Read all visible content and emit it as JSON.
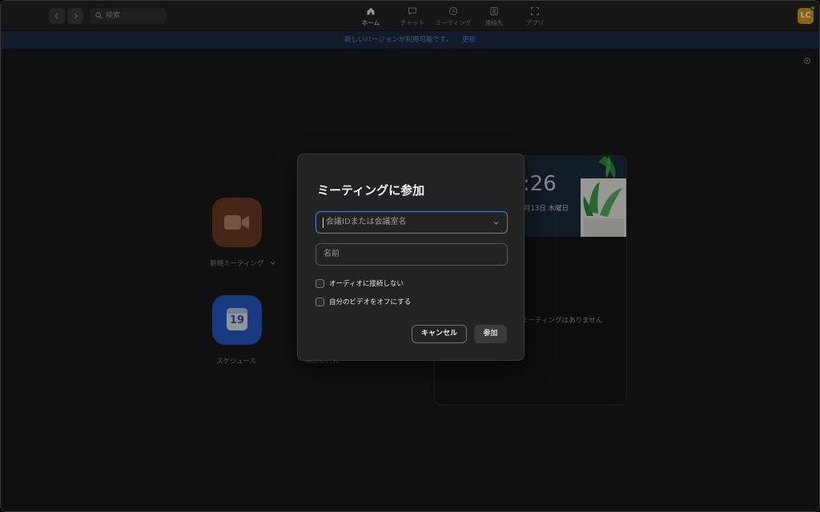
{
  "search": {
    "placeholder": "検索"
  },
  "nav_tabs": [
    {
      "label": "ホーム",
      "icon": "home-icon",
      "active": true
    },
    {
      "label": "チャット",
      "icon": "chat-icon",
      "active": false
    },
    {
      "label": "ミーティング",
      "icon": "clock-icon",
      "active": false
    },
    {
      "label": "連絡先",
      "icon": "contacts-icon",
      "active": false
    },
    {
      "label": "アプリ",
      "icon": "apps-icon",
      "active": false
    }
  ],
  "user": {
    "initials": "LC",
    "presence": "online"
  },
  "banner": {
    "message": "新しいバージョンが利用可能です。",
    "action": "更新"
  },
  "home": {
    "new_meeting_label": "新規ミーティング",
    "schedule_label": "スケジュール",
    "schedule_day": "19",
    "hidden_label": "画面の共有"
  },
  "calendar": {
    "time": ":26",
    "date": "月13日 木曜日",
    "empty": "ミーティングはありません"
  },
  "dialog": {
    "title": "ミーティングに参加",
    "meeting_id_placeholder": "会議IDまたは会議室名",
    "name_placeholder": "名前",
    "option_no_audio": "オーディオに接続しない",
    "option_video_off": "自分のビデオをオフにする",
    "cancel": "キャンセル",
    "join": "参加"
  },
  "colors": {
    "accent": "#3f86ff",
    "avatar": "#d59a20",
    "new_meeting_tile": "#6a3a21",
    "schedule_tile": "#2559c6",
    "focus_border": "#5a7fd0"
  }
}
